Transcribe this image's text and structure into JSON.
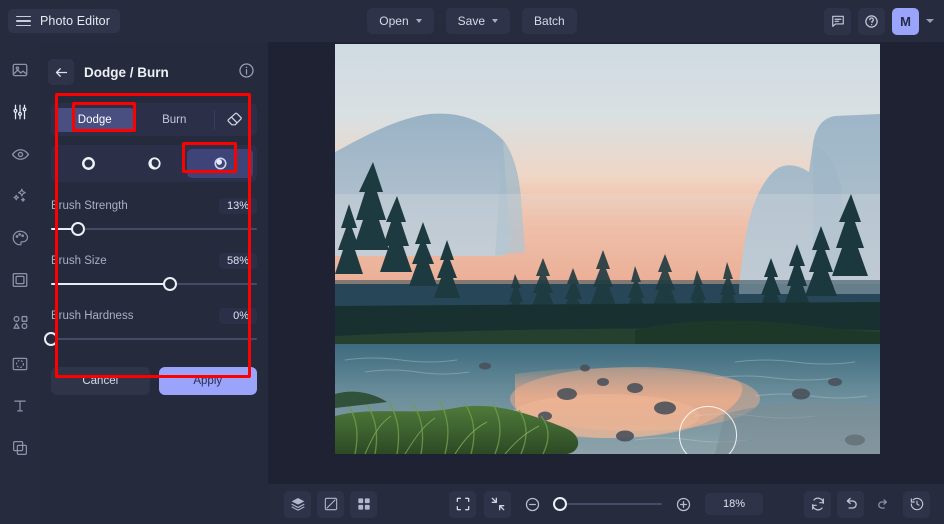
{
  "app": {
    "title": "Photo Editor",
    "menu_icon": "hamburger-icon"
  },
  "topbar": {
    "open_label": "Open",
    "save_label": "Save",
    "batch_label": "Batch",
    "comment_icon": "comment-icon",
    "help_icon": "help-circle-icon",
    "avatar_initial": "M",
    "account_caret_icon": "chevron-down-icon"
  },
  "rail": {
    "items": [
      {
        "name": "image-icon",
        "label": "Image"
      },
      {
        "name": "adjustments-icon",
        "label": "Adjust"
      },
      {
        "name": "eye-icon",
        "label": "Effects"
      },
      {
        "name": "sparkles-icon",
        "label": "Retouch"
      },
      {
        "name": "palette-icon",
        "label": "Color"
      },
      {
        "name": "frame-icon",
        "label": "Frame"
      },
      {
        "name": "shapes-icon",
        "label": "Shapes"
      },
      {
        "name": "cutout-icon",
        "label": "Cutout"
      },
      {
        "name": "text-icon",
        "label": "Text"
      },
      {
        "name": "layers-copy-icon",
        "label": "Layers"
      }
    ]
  },
  "panel": {
    "back_icon": "back-arrow-icon",
    "title": "Dodge / Burn",
    "info_icon": "info-icon",
    "modes": {
      "dodge_label": "Dodge",
      "burn_label": "Burn",
      "eraser_icon": "eraser-icon",
      "selected": "Dodge"
    },
    "tone_ranges": [
      {
        "name": "tone-shadows-icon",
        "label": "Shadows",
        "selected": false
      },
      {
        "name": "tone-midtones-icon",
        "label": "Midtones",
        "selected": false
      },
      {
        "name": "tone-highlights-icon",
        "label": "Highlights",
        "selected": true
      }
    ],
    "sliders": [
      {
        "label": "Brush Strength",
        "value": "13%",
        "percent": 13
      },
      {
        "label": "Brush Size",
        "value": "58%",
        "percent": 58
      },
      {
        "label": "Brush Hardness",
        "value": "0%",
        "percent": 0
      }
    ],
    "cancel_label": "Cancel",
    "apply_label": "Apply"
  },
  "canvas": {
    "brush_cursor": "brush-cursor-circle",
    "photo_description": "Mountain valley at sunrise with river and pine trees"
  },
  "bottombar": {
    "layers_icon": "layers-icon",
    "compare_icon": "compare-split-icon",
    "grid_icon": "grid-icon",
    "fit_screen_icon": "fit-screen-icon",
    "collapse_icon": "collapse-arrows-icon",
    "zoom_out_icon": "zoom-out-icon",
    "zoom_in_icon": "zoom-in-icon",
    "zoom_level": "18%",
    "reset_icon": "reset-icon",
    "undo_icon": "undo-icon",
    "redo_icon": "redo-icon",
    "history_icon": "history-icon"
  },
  "colors": {
    "accent": "#9aa4fb",
    "accent_muted": "#4a4f82",
    "annotation": "#ff0000",
    "panel_bg": "#252a3d",
    "chrome_bg": "#272b3e"
  }
}
